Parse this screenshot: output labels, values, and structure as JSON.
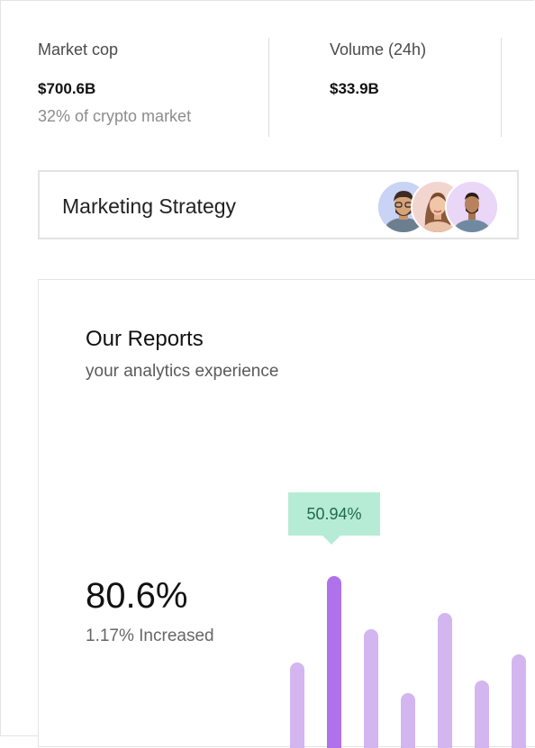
{
  "stats": [
    {
      "label": "Market cop",
      "value": "$700.6B",
      "sub": "32% of crypto market"
    },
    {
      "label": "Volume (24h)",
      "value": "$33.9B",
      "sub": ""
    }
  ],
  "strategy": {
    "title": "Marketing Strategy",
    "avatars": [
      "avatar-man-glasses",
      "avatar-woman",
      "avatar-man-beard"
    ]
  },
  "reports": {
    "title": "Our Reports",
    "subtitle": "your analytics experience",
    "big_value": "80.6%",
    "change_text": "1.17% Increased",
    "tooltip": "50.94%"
  },
  "chart_data": {
    "type": "bar",
    "values": [
      0.47,
      0.94,
      0.65,
      0.3,
      0.74,
      0.37,
      0.51
    ],
    "highlight_index": 1,
    "colors": {
      "bar": "#d3b6f0",
      "highlight": "#af72ec",
      "tooltip_bg": "#b6ecd5",
      "tooltip_text": "#1f6a4c"
    }
  }
}
